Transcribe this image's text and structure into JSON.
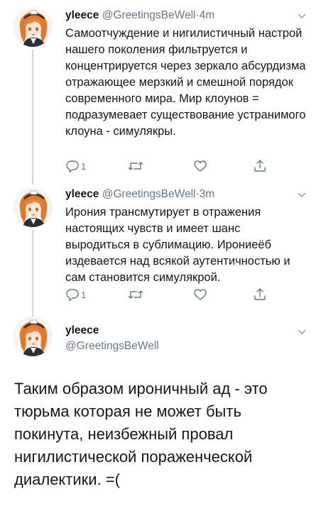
{
  "tweets": [
    {
      "name": "yleece",
      "handle": "@GreetingsBeWell",
      "separator": "·",
      "time": "4m",
      "text": "Самоотчуждение и нигилистичный настрой нашего поколения фильтруется и концентрируется через зеркало абсурдизма отражающее мерзкий и смешной порядок современного мира. Мир клоунов = подразумевает существование устранимого клоуна - симулякры.",
      "reply_count": "1"
    },
    {
      "name": "yleece",
      "handle": "@GreetingsBeWell",
      "separator": "·",
      "time": "3m",
      "text": "Ирония трансмутирует в отражения настоящих чувств и имеет шанс выродиться в сублимацию. Ирониеёб издевается над всякой аутентичностью и сам становится симулякрой.",
      "reply_count": "1"
    }
  ],
  "focused_tweet": {
    "name": "yleece",
    "handle": "@GreetingsBeWell",
    "text": "Таким образом ироничный ад - это тюрьма которая не может быть покинута, неизбежный провал нигилистической пораженческой диалектики. =("
  },
  "icons": [
    "avatar",
    "chevron-down-icon",
    "reply-icon",
    "retweet-icon",
    "like-icon",
    "share-icon"
  ],
  "colors": {
    "text": "#14171a",
    "secondary": "#657786",
    "thread_line": "#ccd6dd",
    "avatar_hair": "#e0782e"
  }
}
